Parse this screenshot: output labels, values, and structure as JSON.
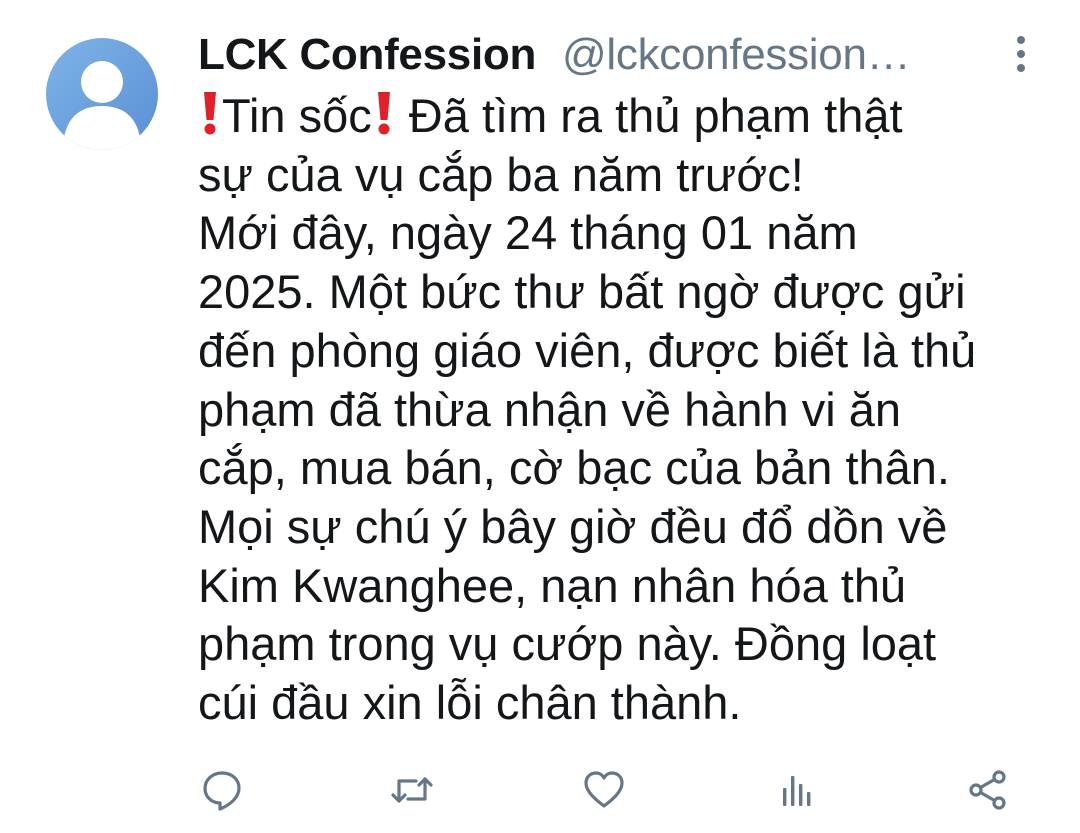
{
  "tweet": {
    "author": {
      "display_name": "LCK Confession",
      "handle": "@lckconfession…",
      "avatar_icon": "default-user-avatar-icon"
    },
    "menu_icon": "more-vertical-icon",
    "text_lines": [
      {
        "emoji_before": true,
        "text_a": "Tin sốc",
        "emoji_after": true,
        "text_b": " Đã tìm ra thủ phạm thật"
      },
      {
        "text": "sự của vụ cắp ba năm trước!"
      },
      {
        "text": "Mới đây, ngày 24 tháng 01 năm"
      },
      {
        "text": "2025. Một bức thư bất ngờ được gửi"
      },
      {
        "text": "đến phòng giáo viên, được biết là thủ"
      },
      {
        "text": "phạm đã thừa nhận về hành vi ăn"
      },
      {
        "text": "cắp, mua bán, cờ bạc của bản thân."
      },
      {
        "text": "Mọi sự chú ý bây giờ đều đổ dồn về"
      },
      {
        "text": "Kim Kwanghee, nạn nhân hóa thủ"
      },
      {
        "text": "phạm trong vụ cướp này. Đồng loạt"
      },
      {
        "text": "cúi đầu xin lỗi chân thành."
      }
    ],
    "emoji": "exclamation-mark-red-icon",
    "actions": [
      {
        "name": "reply",
        "icon": "reply-bubble-icon"
      },
      {
        "name": "retweet",
        "icon": "retweet-icon"
      },
      {
        "name": "like",
        "icon": "heart-icon"
      },
      {
        "name": "analytics",
        "icon": "analytics-bars-icon"
      },
      {
        "name": "share",
        "icon": "share-nodes-icon"
      }
    ]
  },
  "colors": {
    "text": "#14171a",
    "secondary": "#657786",
    "action_icon": "#657786",
    "avatar_bg": "#6fa3df",
    "emoji_red": "#e0202a"
  }
}
